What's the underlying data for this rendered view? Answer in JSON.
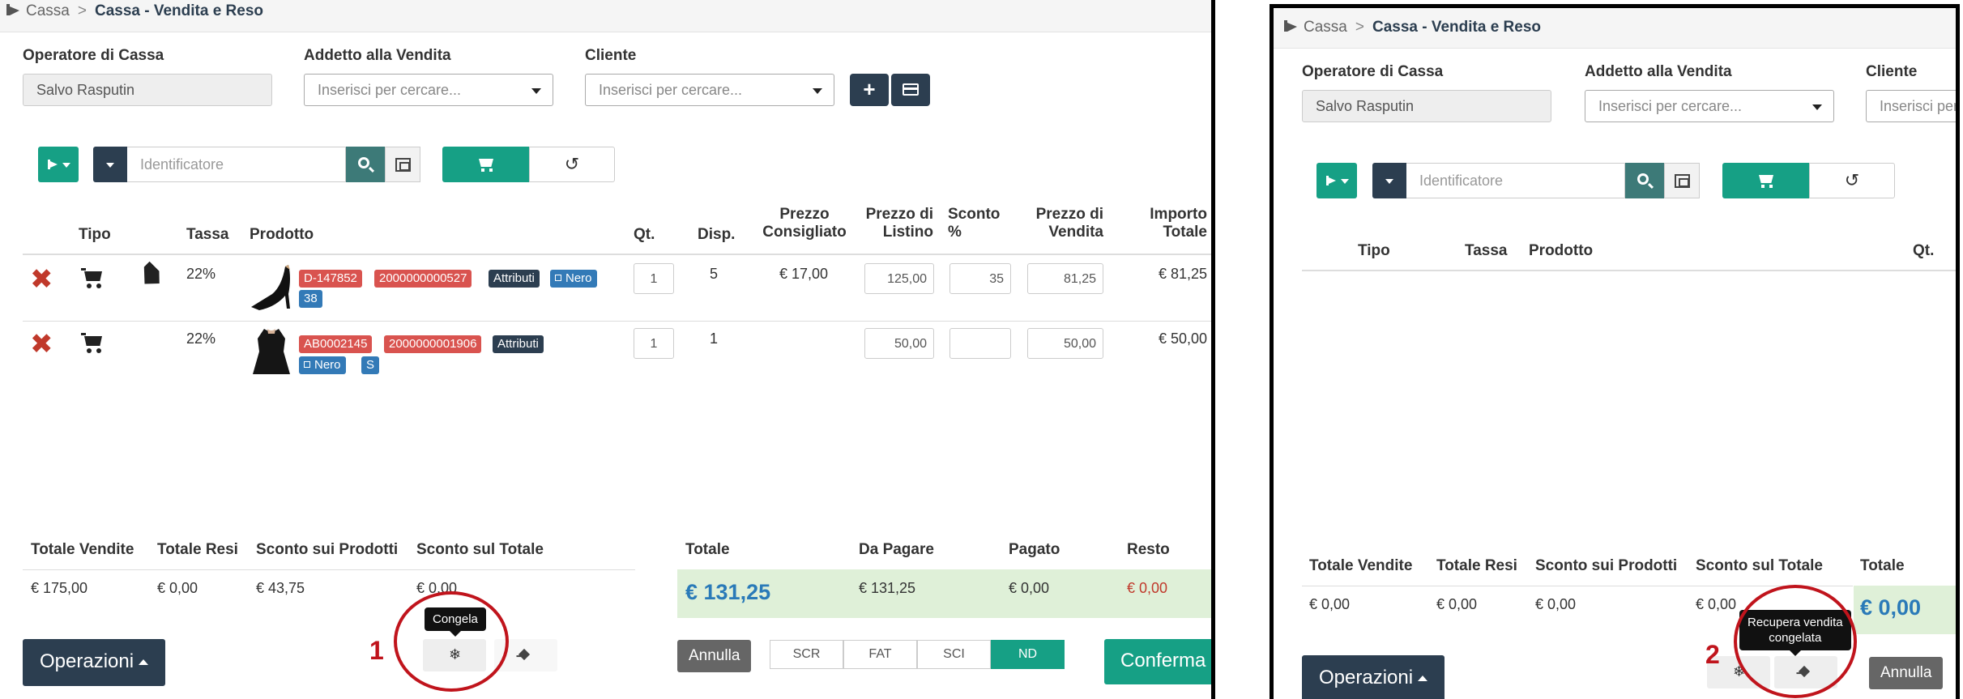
{
  "breadcrumb": {
    "root": "Cassa",
    "separator": ">",
    "current": "Cassa - Vendita e Reso"
  },
  "form": {
    "operatore_label": "Operatore di Cassa",
    "operatore_value": "Salvo Rasputin",
    "addetto_label": "Addetto alla Vendita",
    "addetto_placeholder": "Inserisci per cercare...",
    "cliente_label": "Cliente",
    "cliente_placeholder": "Inserisci per cercare..."
  },
  "toolbar": {
    "identificatore_placeholder": "Identificatore",
    "add_customer_glyph": "+",
    "reset_glyph": "↺"
  },
  "table": {
    "headers": {
      "tipo": "Tipo",
      "tassa": "Tassa",
      "prodotto": "Prodotto",
      "qt": "Qt.",
      "disp": "Disp.",
      "prezzo_consigliato_1": "Prezzo",
      "prezzo_consigliato_2": "Consigliato",
      "prezzo_listino_1": "Prezzo di",
      "prezzo_listino_2": "Listino",
      "sconto_1": "Sconto",
      "sconto_2": "%",
      "prezzo_vendita_1": "Prezzo di",
      "prezzo_vendita_2": "Vendita",
      "importo_1": "Importo",
      "importo_2": "Totale"
    },
    "rows": [
      {
        "tassa": "22%",
        "badges": [
          "D-147852",
          "2000000000527",
          "Attributi",
          "Nero",
          "38"
        ],
        "qt": "1",
        "disp": "5",
        "prezzo_consigliato": "€ 17,00",
        "prezzo_listino": "125,00",
        "sconto": "35",
        "prezzo_vendita": "81,25",
        "importo": "€ 81,25"
      },
      {
        "tassa": "22%",
        "badges": [
          "AB0002145",
          "2000000001906",
          "Attributi",
          "Nero",
          "S"
        ],
        "qt": "1",
        "disp": "1",
        "prezzo_consigliato": "",
        "prezzo_listino": "50,00",
        "sconto": "",
        "prezzo_vendita": "50,00",
        "importo": "€ 50,00"
      }
    ]
  },
  "summary_left": {
    "headers": {
      "totale_vendite": "Totale Vendite",
      "totale_resi": "Totale Resi",
      "sconto_prodotti": "Sconto sui Prodotti",
      "sconto_totale": "Sconto sul Totale"
    },
    "values": {
      "totale_vendite": "€ 175,00",
      "totale_resi": "€ 0,00",
      "sconto_prodotti": "€ 43,75",
      "sconto_totale": "€ 0,00"
    }
  },
  "summary_right": {
    "headers": {
      "totale": "Totale",
      "da_pagare": "Da Pagare",
      "pagato": "Pagato",
      "resto": "Resto"
    },
    "values": {
      "totale": "€ 131,25",
      "da_pagare": "€ 131,25",
      "pagato": "€ 0,00",
      "resto": "€ 0,00"
    }
  },
  "footer": {
    "operazioni": "Operazioni",
    "annulla": "Annulla",
    "conferma": "Conferma",
    "doc_types": [
      "SCR",
      "FAT",
      "SCI",
      "ND"
    ],
    "freeze_glyph": "❄"
  },
  "tooltips": {
    "congela": "Congela",
    "recupera_1": "Recupera vendita",
    "recupera_2": "congelata"
  },
  "annotations": {
    "step1": "1",
    "step2": "2"
  },
  "right_panel": {
    "summary_values": {
      "totale_vendite": "€ 0,00",
      "totale_resi": "€ 0,00",
      "sconto_prodotti": "€ 0,00",
      "sconto_totale": "€ 0,00",
      "totale": "€ 0,00"
    }
  },
  "colors": {
    "teal": "#16a085",
    "navy": "#2c3e50",
    "badge_red": "#d9534f",
    "badge_blue": "#337ab7",
    "highlight_ring": "#c0141c",
    "total_band": "#dff0d8"
  }
}
